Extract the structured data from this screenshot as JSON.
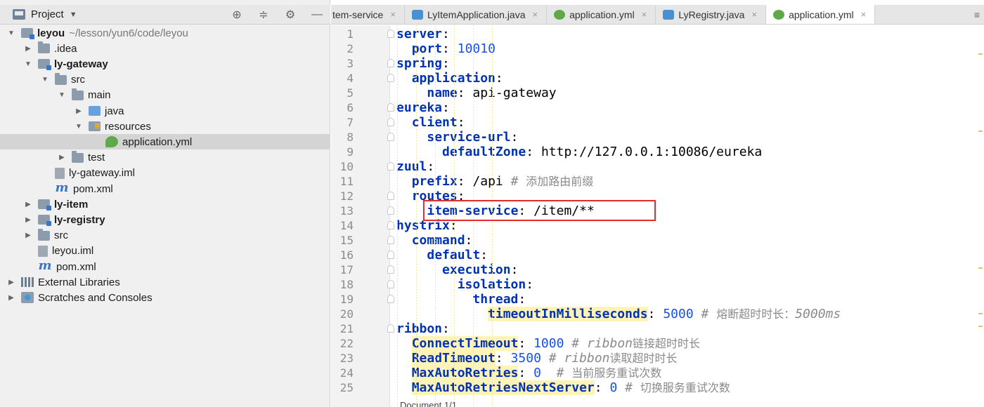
{
  "project_panel": {
    "title": "Project",
    "tree": [
      {
        "label": "leyou",
        "suffix": "~/lesson/yun6/code/leyou",
        "depth": 0,
        "icon": "module",
        "twisty": "open",
        "bold": true
      },
      {
        "label": ".idea",
        "depth": 1,
        "icon": "folder",
        "twisty": "closed"
      },
      {
        "label": "ly-gateway",
        "depth": 1,
        "icon": "module",
        "twisty": "open",
        "bold": true
      },
      {
        "label": "src",
        "depth": 2,
        "icon": "folder",
        "twisty": "open"
      },
      {
        "label": "main",
        "depth": 3,
        "icon": "folder",
        "twisty": "open"
      },
      {
        "label": "java",
        "depth": 4,
        "icon": "src-folder",
        "twisty": "closed"
      },
      {
        "label": "resources",
        "depth": 4,
        "icon": "res-folder",
        "twisty": "open"
      },
      {
        "label": "application.yml",
        "depth": 5,
        "icon": "spring",
        "twisty": "none",
        "selected": true
      },
      {
        "label": "test",
        "depth": 3,
        "icon": "folder",
        "twisty": "closed"
      },
      {
        "label": "ly-gateway.iml",
        "depth": 2,
        "icon": "iml",
        "twisty": "none"
      },
      {
        "label": "pom.xml",
        "depth": 2,
        "icon": "maven",
        "twisty": "none"
      },
      {
        "label": "ly-item",
        "depth": 1,
        "icon": "module",
        "twisty": "closed",
        "bold": true
      },
      {
        "label": "ly-registry",
        "depth": 1,
        "icon": "module",
        "twisty": "closed",
        "bold": true
      },
      {
        "label": "src",
        "depth": 1,
        "icon": "folder",
        "twisty": "closed"
      },
      {
        "label": "leyou.iml",
        "depth": 1,
        "icon": "iml",
        "twisty": "none"
      },
      {
        "label": "pom.xml",
        "depth": 1,
        "icon": "maven",
        "twisty": "none"
      },
      {
        "label": "External Libraries",
        "depth": 0,
        "icon": "lib",
        "twisty": "closed"
      },
      {
        "label": "Scratches and Consoles",
        "depth": 0,
        "icon": "scratch",
        "twisty": "closed"
      }
    ]
  },
  "tabs": [
    {
      "label": "tem-service",
      "icon": "",
      "cut": true
    },
    {
      "label": "LyItemApplication.java",
      "icon": "java"
    },
    {
      "label": "application.yml",
      "icon": "yml"
    },
    {
      "label": "LyRegistry.java",
      "icon": "java"
    },
    {
      "label": "application.yml",
      "icon": "yml",
      "active": true
    }
  ],
  "code_lines": [
    [
      {
        "t": "server",
        "c": "k"
      },
      {
        "t": ":"
      }
    ],
    [
      {
        "t": "  "
      },
      {
        "t": "port",
        "c": "k"
      },
      {
        "t": ": "
      },
      {
        "t": "10010",
        "c": "num"
      }
    ],
    [
      {
        "t": "spring",
        "c": "k"
      },
      {
        "t": ":"
      }
    ],
    [
      {
        "t": "  "
      },
      {
        "t": "application",
        "c": "k"
      },
      {
        "t": ":"
      }
    ],
    [
      {
        "t": "    "
      },
      {
        "t": "name",
        "c": "k"
      },
      {
        "t": ": "
      },
      {
        "t": "api-gateway",
        "c": "v plain"
      }
    ],
    [
      {
        "t": "eureka",
        "c": "k"
      },
      {
        "t": ":"
      }
    ],
    [
      {
        "t": "  "
      },
      {
        "t": "client",
        "c": "k"
      },
      {
        "t": ":"
      }
    ],
    [
      {
        "t": "    "
      },
      {
        "t": "service-url",
        "c": "k"
      },
      {
        "t": ":"
      }
    ],
    [
      {
        "t": "      "
      },
      {
        "t": "defaultZone",
        "c": "k"
      },
      {
        "t": ": "
      },
      {
        "t": "http://127.0.0.1:10086/eureka",
        "c": "v plain"
      }
    ],
    [
      {
        "t": "zuul",
        "c": "k"
      },
      {
        "t": ":"
      }
    ],
    [
      {
        "t": "  "
      },
      {
        "t": "prefix",
        "c": "k"
      },
      {
        "t": ": "
      },
      {
        "t": "/api ",
        "c": "v plain"
      },
      {
        "t": "# ",
        "c": "c"
      },
      {
        "t": "添加路由前缀",
        "c": "c cn"
      }
    ],
    [
      {
        "t": "  "
      },
      {
        "t": "routes",
        "c": "k"
      },
      {
        "t": ":"
      }
    ],
    [
      {
        "t": "    "
      },
      {
        "t": "item-service",
        "c": "k"
      },
      {
        "t": ": "
      },
      {
        "t": "/item/**",
        "c": "v plain"
      }
    ],
    [
      {
        "t": "hystrix",
        "c": "k"
      },
      {
        "t": ":"
      }
    ],
    [
      {
        "t": "  "
      },
      {
        "t": "command",
        "c": "k"
      },
      {
        "t": ":"
      }
    ],
    [
      {
        "t": "    "
      },
      {
        "t": "default",
        "c": "k"
      },
      {
        "t": ":"
      }
    ],
    [
      {
        "t": "      "
      },
      {
        "t": "execution",
        "c": "k"
      },
      {
        "t": ":"
      }
    ],
    [
      {
        "t": "        "
      },
      {
        "t": "isolation",
        "c": "k"
      },
      {
        "t": ":"
      }
    ],
    [
      {
        "t": "          "
      },
      {
        "t": "thread",
        "c": "k"
      },
      {
        "t": ":"
      }
    ],
    [
      {
        "t": "            "
      },
      {
        "t": "timeoutInMilliseconds",
        "c": "k hl"
      },
      {
        "t": ": "
      },
      {
        "t": "5000",
        "c": "num"
      },
      {
        "t": " # ",
        "c": "c"
      },
      {
        "t": "熔断超时时长：",
        "c": "c cn"
      },
      {
        "t": "5000ms",
        "c": "c"
      }
    ],
    [
      {
        "t": "ribbon",
        "c": "k"
      },
      {
        "t": ":"
      }
    ],
    [
      {
        "t": "  "
      },
      {
        "t": "ConnectTimeout",
        "c": "k hl"
      },
      {
        "t": ": "
      },
      {
        "t": "1000",
        "c": "num"
      },
      {
        "t": " # ",
        "c": "c"
      },
      {
        "t": "ribbon",
        "c": "c"
      },
      {
        "t": "链接超时时长",
        "c": "c cn"
      }
    ],
    [
      {
        "t": "  "
      },
      {
        "t": "ReadTimeout",
        "c": "k hl"
      },
      {
        "t": ": "
      },
      {
        "t": "3500",
        "c": "num"
      },
      {
        "t": " # ",
        "c": "c"
      },
      {
        "t": "ribbon",
        "c": "c"
      },
      {
        "t": "读取超时时长",
        "c": "c cn"
      }
    ],
    [
      {
        "t": "  "
      },
      {
        "t": "MaxAutoRetries",
        "c": "k hl"
      },
      {
        "t": ": "
      },
      {
        "t": "0",
        "c": "num"
      },
      {
        "t": "  # ",
        "c": "c"
      },
      {
        "t": "当前服务重试次数",
        "c": "c cn"
      }
    ],
    [
      {
        "t": "  "
      },
      {
        "t": "MaxAutoRetriesNextServer",
        "c": "k hl"
      },
      {
        "t": ": "
      },
      {
        "t": "0",
        "c": "num"
      },
      {
        "t": " # ",
        "c": "c"
      },
      {
        "t": "切换服务重试次数",
        "c": "c cn"
      }
    ]
  ],
  "highlighted_line": 13,
  "status_text": "Document 1/1",
  "colors": {
    "highlight_box": "#e02d2d",
    "keyword": "#0033b3",
    "number": "#1750eb",
    "comment": "#8a8a8a"
  }
}
